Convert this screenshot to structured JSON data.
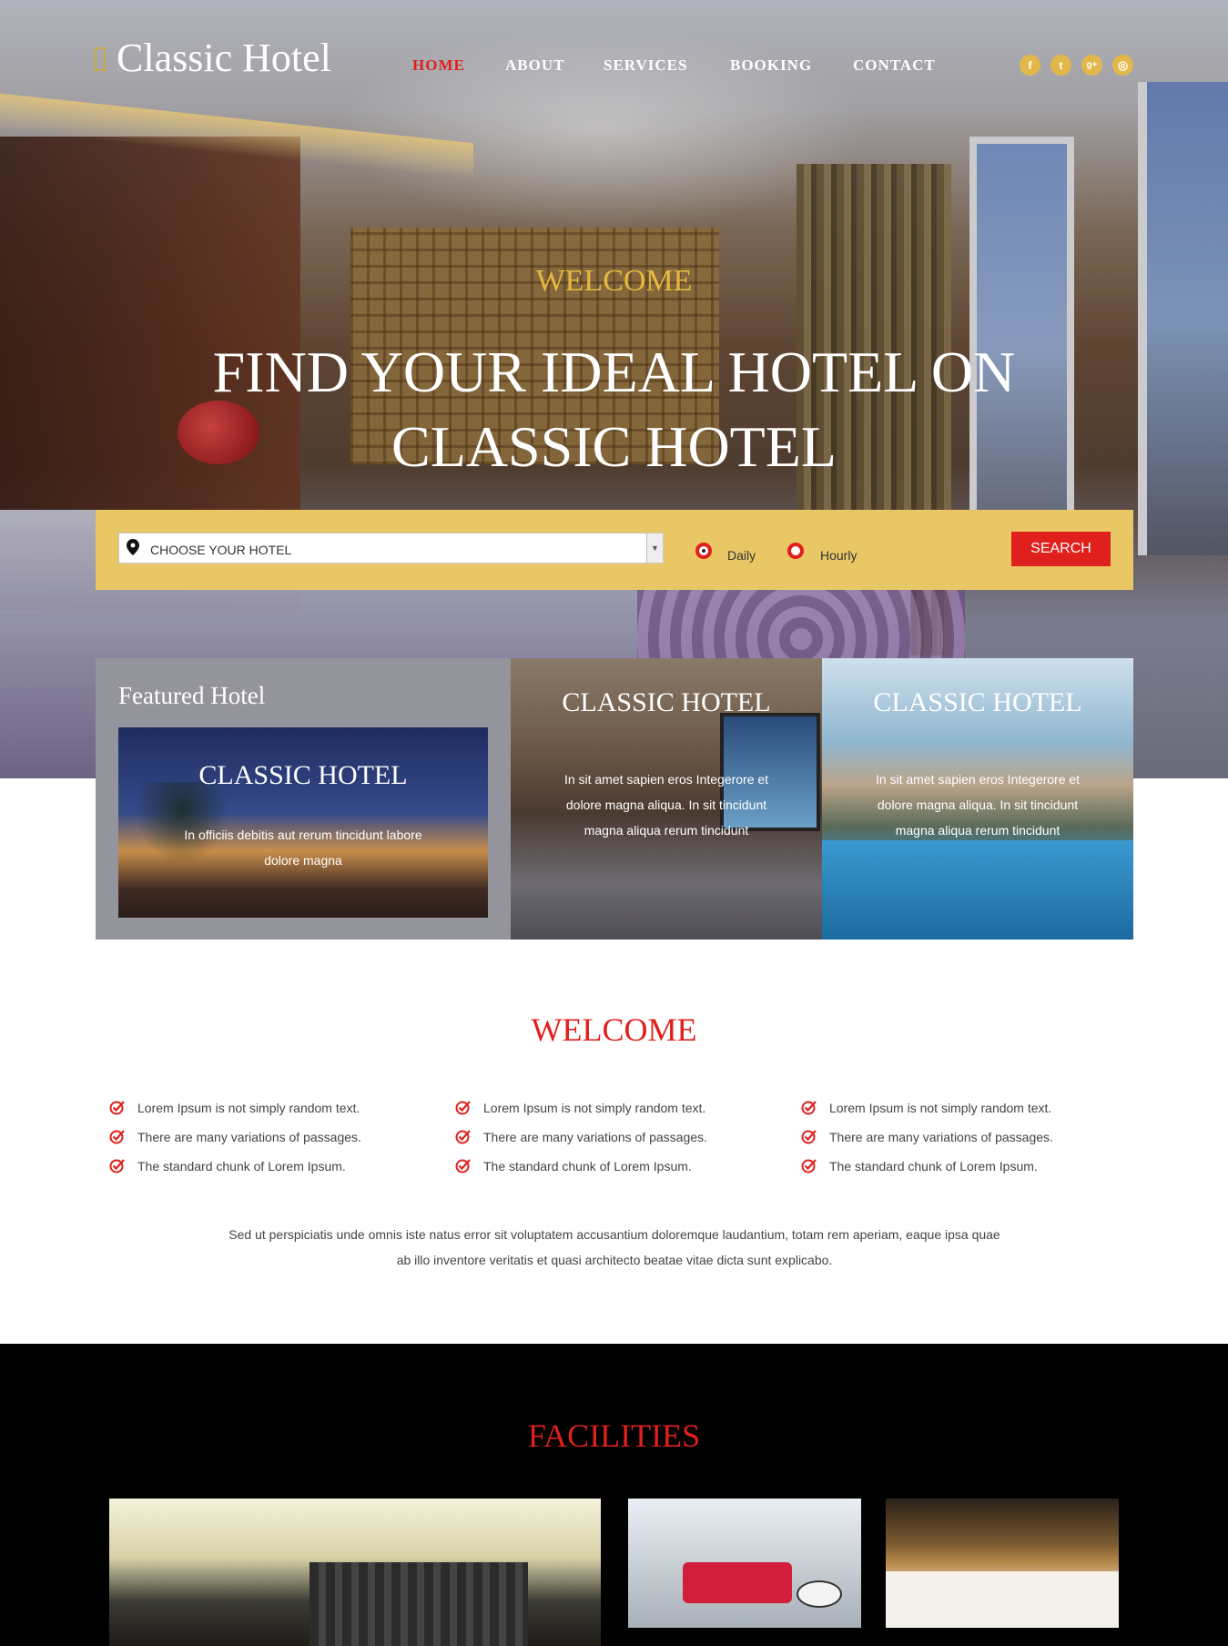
{
  "header": {
    "logo_text": "Classic Hotel",
    "nav": [
      {
        "label": "HOME",
        "active": true
      },
      {
        "label": "ABOUT",
        "active": false
      },
      {
        "label": "SERVICES",
        "active": false
      },
      {
        "label": "BOOKING",
        "active": false
      },
      {
        "label": "CONTACT",
        "active": false
      }
    ],
    "social": [
      {
        "icon": "facebook-icon",
        "glyph": "f"
      },
      {
        "icon": "twitter-icon",
        "glyph": "t"
      },
      {
        "icon": "google-plus-icon",
        "glyph": "g+"
      },
      {
        "icon": "dribbble-icon",
        "glyph": "◎"
      }
    ]
  },
  "hero": {
    "welcome": "WELCOME",
    "title": "FIND YOUR IDEAL HOTEL ON CLASSIC HOTEL"
  },
  "search": {
    "select_value": "CHOOSE YOUR HOTEL",
    "radio_options": [
      {
        "label": "Daily",
        "checked": true
      },
      {
        "label": "Hourly",
        "checked": false
      }
    ],
    "button_label": "SEARCH"
  },
  "featured": {
    "heading": "Featured Hotel",
    "card": {
      "title": "CLASSIC HOTEL",
      "text": "In officiis debitis aut rerum tincidunt labore dolore magna"
    }
  },
  "cards": [
    {
      "title": "CLASSIC HOTEL",
      "text": "In sit amet sapien eros Integerore et dolore magna aliqua. In sit tincidunt magna aliqua rerum tincidunt"
    },
    {
      "title": "CLASSIC HOTEL",
      "text": "In sit amet sapien eros Integerore et dolore magna aliqua. In sit tincidunt magna aliqua rerum tincidunt"
    }
  ],
  "welcome": {
    "heading": "WELCOME",
    "columns": [
      [
        "Lorem Ipsum is not simply random text.",
        "There are many variations of passages.",
        "The standard chunk of Lorem Ipsum."
      ],
      [
        "Lorem Ipsum is not simply random text.",
        "There are many variations of passages.",
        "The standard chunk of Lorem Ipsum."
      ],
      [
        "Lorem Ipsum is not simply random text.",
        "There are many variations of passages.",
        "The standard chunk of Lorem Ipsum."
      ]
    ],
    "paragraph": "Sed ut perspiciatis unde omnis iste natus error sit voluptatem accusantium doloremque laudantium, totam rem aperiam, eaque ipsa quae ab illo inventore veritatis et quasi architecto beatae vitae dicta sunt explicabo."
  },
  "facilities": {
    "heading": "FACILITIES"
  },
  "colors": {
    "accent_red": "#e0201c",
    "gold": "#e9c765",
    "social_gold": "#e3b84a",
    "featured_grey": "#94949c"
  }
}
